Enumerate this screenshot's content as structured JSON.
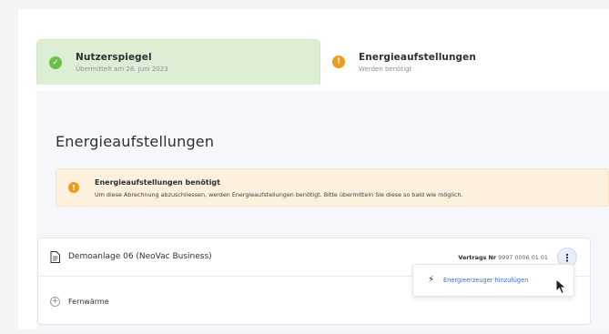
{
  "steps": [
    {
      "title": "Nutzerspiegel",
      "subtitle": "Übermittelt am 28. Juni 2023",
      "status": "done",
      "icon": "check-icon"
    },
    {
      "title": "Energieaufstellungen",
      "subtitle": "Werden benötigt",
      "status": "pending",
      "icon": "warning-icon"
    }
  ],
  "page": {
    "title": "Energieaufstellungen"
  },
  "alert": {
    "title": "Energieaufstellungen benötigt",
    "text": "Um diese Abrechnung abzuschliessen, werden Energieaufstellungen benötigt. Bitte übermitteln Sie diese so bald wie möglich."
  },
  "card": {
    "title": "Demoanlage 06 (NeoVac Business)",
    "contract_label": "Vertrags Nr",
    "contract_value": "9997 0006 01 01",
    "rows": [
      {
        "label": "Fernwärme"
      }
    ]
  },
  "menu": {
    "items": [
      {
        "label": "Energieerzeuger hinzufügen",
        "icon": "bolt-icon"
      }
    ]
  },
  "icons": {
    "check": "✓",
    "warn": "!",
    "more": "⋮",
    "plus": "+",
    "bolt": "⚡"
  },
  "colors": {
    "success": "#6cc04a",
    "warning": "#f29a1c",
    "link": "#3d6bd8",
    "alert_bg": "#fdf0dc",
    "done_bg": "#dcefd4"
  }
}
